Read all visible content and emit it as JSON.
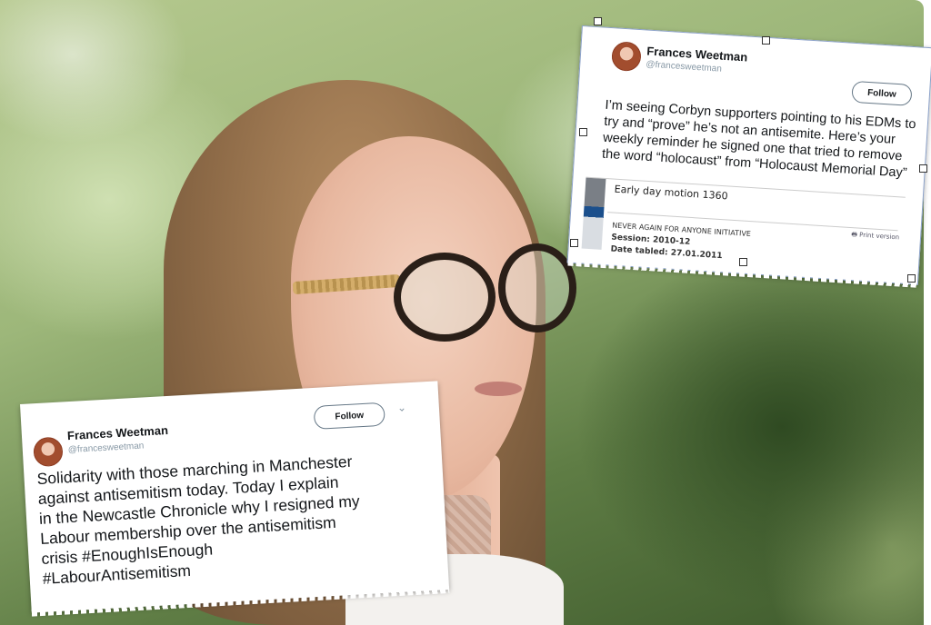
{
  "tweet_top": {
    "name": "Frances Weetman",
    "handle": "@francesweetman",
    "follow_label": "Follow",
    "text": "I’m seeing Corbyn supporters pointing to his EDMs to try and “prove” he’s not an antisemite. Here’s your weekly reminder he signed one that tried to remove the word “holocaust” from “Holocaust Memorial Day”",
    "embed": {
      "title": "Early day motion 1360",
      "print_label": "Print version",
      "initiative": "NEVER AGAIN FOR ANYONE INITIATIVE",
      "session": "Session: 2010-12",
      "date": "Date tabled: 27.01.2011"
    }
  },
  "tweet_bottom": {
    "name": "Frances Weetman",
    "handle": "@francesweetman",
    "follow_label": "Follow",
    "text_lines": [
      "Solidarity with those marching in Manchester",
      "against antisemitism today.  Today I explain",
      "in the Newcastle Chronicle why I resigned my",
      "Labour membership over the antisemitism",
      "crisis #EnoughIsEnough",
      "#LabourAntisemitism"
    ]
  },
  "icons": [
    "avatar",
    "chevron-down-icon",
    "printer-icon"
  ]
}
